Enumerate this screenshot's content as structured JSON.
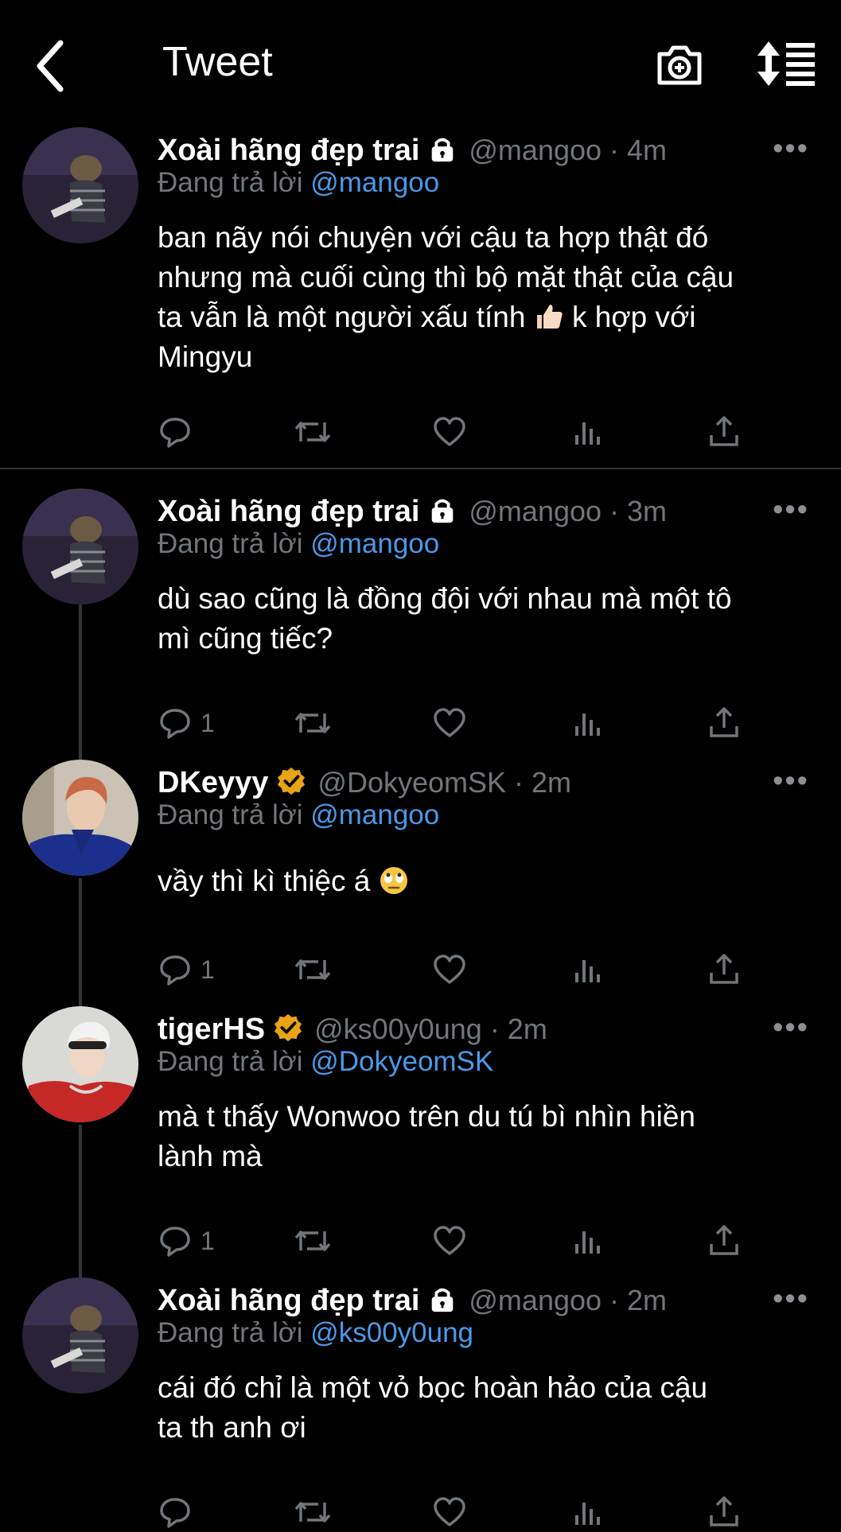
{
  "header": {
    "title": "Tweet",
    "back_icon": "chevron-left-icon",
    "camera_icon": "camera-add-icon",
    "sort_icon": "sort-list-icon"
  },
  "reply_prefix": "Đang trả lời",
  "tweets": [
    {
      "name": "Xoài hãng đẹp trai",
      "badge": "lock",
      "handle": "@mangoo",
      "time": "4m",
      "meta": "@mangoo · 4m",
      "reply_to": "@mangoo",
      "text_lines": [
        "ban nãy nói chuyện với cậu ta hợp thật đó",
        "nhưng mà cuối cùng thì bộ mặt thật của cậu",
        "ta vẫn là một người xấu tính",
        "k hợp với",
        "Mingyu"
      ],
      "reply_count": ""
    },
    {
      "name": "Xoài hãng đẹp trai",
      "badge": "lock",
      "handle": "@mangoo",
      "time": "3m",
      "meta": "@mangoo · 3m",
      "reply_to": "@mangoo",
      "text_lines": [
        "dù sao cũng là đồng đội với nhau mà một tô",
        "mì cũng tiếc?"
      ],
      "reply_count": "1"
    },
    {
      "name": "DKeyyy",
      "badge": "verified",
      "handle": "@DokyeomSK",
      "time": "2m",
      "meta": "@DokyeomSK · 2m",
      "reply_to": "@mangoo",
      "text_lines": [
        "vầy thì kì thiệc á"
      ],
      "reply_count": "1"
    },
    {
      "name": "tigerHS",
      "badge": "verified",
      "handle": "@ks00y0ung",
      "time": "2m",
      "meta": "@ks00y0ung · 2m",
      "reply_to": "@DokyeomSK",
      "text_lines": [
        "mà t thấy Wonwoo trên du tú bì nhìn hiền",
        "lành mà"
      ],
      "reply_count": "1"
    },
    {
      "name": "Xoài hãng đẹp trai",
      "badge": "lock",
      "handle": "@mangoo",
      "time": "2m",
      "meta": "@mangoo · 2m",
      "reply_to": "@ks00y0ung",
      "text_lines": [
        "cái đó chỉ là một vỏ bọc hoàn hảo của cậu",
        "ta th anh ơi"
      ],
      "reply_count": ""
    }
  ],
  "icons": {
    "reply": "reply-icon",
    "retweet": "retweet-icon",
    "like": "heart-icon",
    "views": "analytics-icon",
    "share": "share-icon",
    "more": "more-icon"
  },
  "colors": {
    "background": "#000000",
    "link": "#4a99e9",
    "muted": "#71767b",
    "verified": "#e8a317"
  }
}
